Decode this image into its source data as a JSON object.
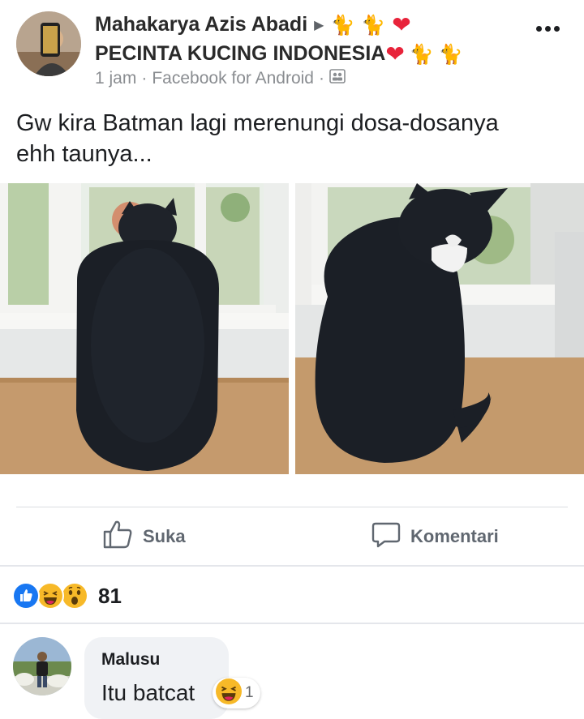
{
  "post": {
    "author": "Mahakarya Azis Abadi",
    "group": "PECINTA KUCING INDONESIA",
    "time": "1 jam",
    "source": "Facebook for Android",
    "separator": "·",
    "text_line1": "Gw kira Batman lagi merenungi dosa-dosanya",
    "text_line2": "ehh taunya...",
    "header_icons": [
      "cat-icon",
      "heart-icon"
    ],
    "privacy_icon": "friends-icon"
  },
  "actions": {
    "like_label": "Suka",
    "comment_label": "Komentari"
  },
  "reactions": {
    "types": [
      "like",
      "haha",
      "wow"
    ],
    "count": "81"
  },
  "comment": {
    "author": "Malusu",
    "text": "Itu batcat",
    "reaction_type": "haha",
    "reaction_count": "1"
  },
  "colors": {
    "like_blue": "#1877f2",
    "heart_red": "#e8233a",
    "reaction_yellow": "#f7b928",
    "secondary_text": "#606770",
    "bubble_gray": "#f0f2f5"
  }
}
